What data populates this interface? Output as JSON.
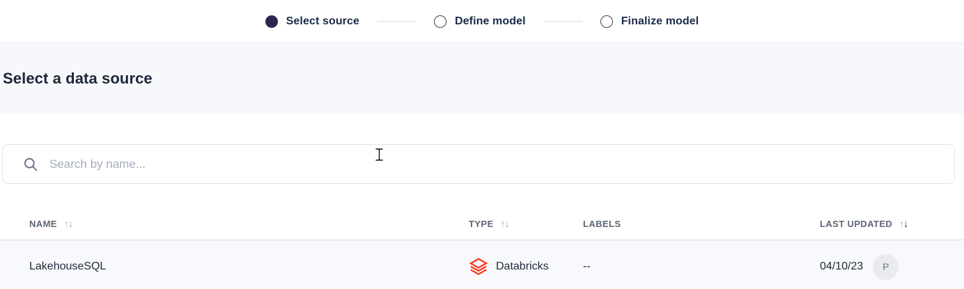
{
  "stepper": {
    "steps": [
      {
        "label": "Select source",
        "state": "active"
      },
      {
        "label": "Define model",
        "state": "inactive"
      },
      {
        "label": "Finalize model",
        "state": "inactive"
      }
    ]
  },
  "page": {
    "title": "Select a data source"
  },
  "search": {
    "placeholder": "Search by name...",
    "value": ""
  },
  "icons": {
    "sort_asc": "↑",
    "sort_desc": "↓",
    "search": "magnifier",
    "databricks": "databricks-stacked-layers"
  },
  "table": {
    "columns": [
      {
        "label": "NAME",
        "sortable": true,
        "sort": "none"
      },
      {
        "label": "TYPE",
        "sortable": true,
        "sort": "none"
      },
      {
        "label": "LABELS",
        "sortable": false,
        "sort": "none"
      },
      {
        "label": "LAST UPDATED",
        "sortable": true,
        "sort": "desc"
      }
    ],
    "rows": [
      {
        "name": "LakehouseSQL",
        "type": "Databricks",
        "labels": "--",
        "last_updated": "04/10/23",
        "avatar_initial": "P"
      }
    ]
  },
  "colors": {
    "step_active_fill": "#2d2655",
    "databricks_red": "#ff3621",
    "band_background": "#f7f8fb",
    "row_background": "#f8f9fc"
  }
}
